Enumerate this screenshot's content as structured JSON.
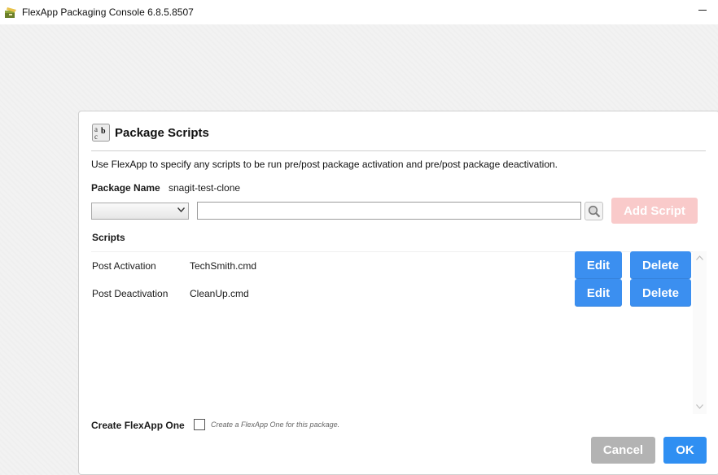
{
  "window": {
    "title": "FlexApp Packaging Console 6.8.5.8507",
    "icon": "flexapp-logo-icon"
  },
  "dialog": {
    "title": "Package Scripts",
    "icon": "text-script-icon",
    "description": "Use FlexApp to specify any scripts to be run pre/post package activation and pre/post package deactivation.",
    "package_name_label": "Package Name",
    "package_name_value": "snagit-test-clone",
    "script_type_selected": "",
    "script_path_value": "",
    "script_path_placeholder": "",
    "browse_icon": "magnifier-icon",
    "add_script_label": "Add Script",
    "scripts_label": "Scripts",
    "scripts": [
      {
        "type": "Post Activation",
        "file": "TechSmith.cmd",
        "edit_label": "Edit",
        "delete_label": "Delete"
      },
      {
        "type": "Post Deactivation",
        "file": "CleanUp.cmd",
        "edit_label": "Edit",
        "delete_label": "Delete"
      }
    ],
    "create_flexapp_one_label": "Create FlexApp One",
    "create_flexapp_one_checked": false,
    "create_flexapp_one_hint": "Create a FlexApp One for this package.",
    "cancel_label": "Cancel",
    "ok_label": "OK"
  },
  "colors": {
    "primary_button": "#3b8ff0",
    "disabled_danger_button": "#f9caca",
    "cancel_button": "#b3b3b3"
  }
}
